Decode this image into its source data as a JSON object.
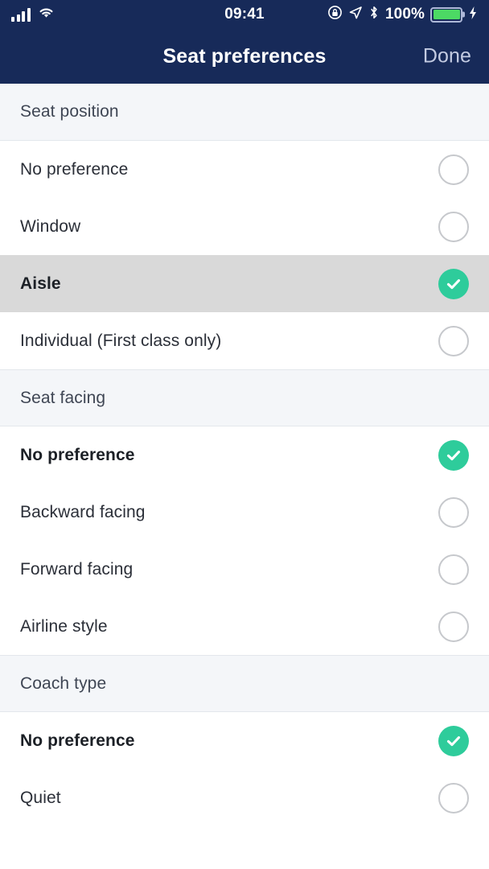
{
  "status_bar": {
    "signal_icon": "cellular-signal-icon",
    "wifi_icon": "wifi-icon",
    "time": "09:41",
    "rotation_lock_icon": "rotation-lock-icon",
    "location_icon": "location-arrow-icon",
    "bluetooth_icon": "bluetooth-icon",
    "battery_percent": "100%",
    "battery_icon": "battery-full-icon",
    "charging_icon": "lightning-bolt-icon",
    "battery_fill_color": "#4CD964"
  },
  "nav": {
    "title": "Seat preferences",
    "done_label": "Done",
    "background_color": "#172A59",
    "done_color": "#C3CBE2"
  },
  "theme": {
    "accent_green": "#2ECC9B",
    "section_header_bg": "#F4F6F9",
    "pressed_row_bg": "#D9D9D9",
    "radio_border": "#C6C8CC"
  },
  "sections": [
    {
      "title": "Seat position",
      "options": [
        {
          "label": "No preference",
          "selected": false,
          "pressed": false
        },
        {
          "label": "Window",
          "selected": false,
          "pressed": false
        },
        {
          "label": "Aisle",
          "selected": true,
          "pressed": true
        },
        {
          "label": "Individual (First class only)",
          "selected": false,
          "pressed": false
        }
      ]
    },
    {
      "title": "Seat facing",
      "options": [
        {
          "label": "No preference",
          "selected": true,
          "pressed": false
        },
        {
          "label": "Backward facing",
          "selected": false,
          "pressed": false
        },
        {
          "label": "Forward facing",
          "selected": false,
          "pressed": false
        },
        {
          "label": "Airline style",
          "selected": false,
          "pressed": false
        }
      ]
    },
    {
      "title": "Coach type",
      "options": [
        {
          "label": "No preference",
          "selected": true,
          "pressed": false
        },
        {
          "label": "Quiet",
          "selected": false,
          "pressed": false
        }
      ]
    }
  ]
}
